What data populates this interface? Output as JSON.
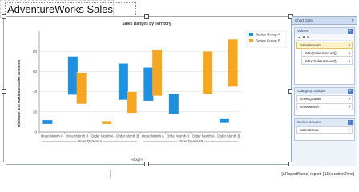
{
  "report": {
    "title": "AdventureWorks Sales",
    "footer_expression": "[&ReportName] report: [&ExecutionTime]"
  },
  "chart_data": {
    "type": "bar",
    "subtype": "range-column",
    "title": "Sales Ranges by Territory",
    "ylabel": "Minimum and Maximum Sales Amounts",
    "xlabel": "«Expr»",
    "ylim": [
      0,
      100
    ],
    "yticks": [
      0,
      20,
      40,
      60,
      80
    ],
    "grid": true,
    "legend_position": "top-right",
    "categories": [
      "Order Month A",
      "Order Month B",
      "Order Month A",
      "Order Month B",
      "Order Month A",
      "Order Month B",
      "Order Month A",
      "Order Month B"
    ],
    "category_groups": [
      {
        "label": "Order Quarter A",
        "span": [
          0,
          3
        ]
      },
      {
        "label": "Order Quarter B",
        "span": [
          4,
          7
        ]
      }
    ],
    "series": [
      {
        "name": "Series Group A",
        "color": "#1f8fe0",
        "low": [
          8,
          37,
          32,
          31,
          18,
          9
        ],
        "high": [
          12,
          75,
          68,
          64,
          38,
          13
        ],
        "at_category": [
          0,
          1,
          3,
          4,
          5,
          7
        ]
      },
      {
        "name": "Series Group B",
        "color": "#f5a623",
        "low": [
          28,
          8,
          19,
          36,
          38,
          45
        ],
        "high": [
          59,
          11,
          40,
          82,
          80,
          92
        ],
        "at_category": [
          1,
          2,
          3,
          4,
          6,
          7
        ]
      }
    ]
  },
  "chart_data_pane": {
    "title": "Chart Data",
    "values_section": {
      "label": "Values",
      "tools": "▲ ▼ ✕",
      "items": [
        {
          "label": "SalesAmount",
          "selected": true
        },
        {
          "label": "[Min(SalesAmount)]"
        },
        {
          "label": "[Max(SalesAmount)]"
        }
      ]
    },
    "category_section": {
      "label": "Category Groups",
      "items": [
        {
          "label": "OrderQuarter"
        },
        {
          "label": "OrderMonth"
        }
      ]
    },
    "series_section": {
      "label": "Series Groups",
      "items": [
        {
          "label": "SalesGroup"
        }
      ]
    }
  },
  "icons": {
    "pin": "pin-icon",
    "dropdown": "dropdown-icon",
    "add": "add-field-icon"
  }
}
